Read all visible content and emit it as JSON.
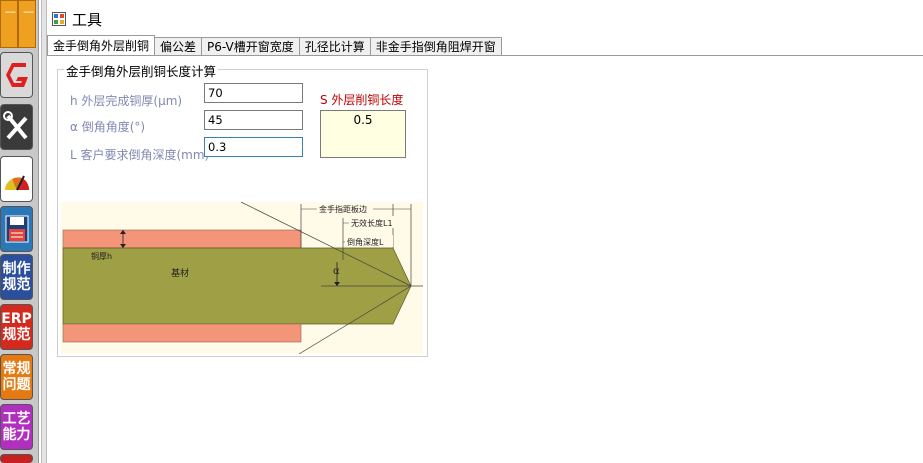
{
  "window": {
    "title": "工具"
  },
  "dock": {
    "items": [
      {
        "icon": "logo-g-icon"
      },
      {
        "icon": "tools-icon"
      },
      {
        "icon": "gauge-icon"
      },
      {
        "icon": "save-icon"
      },
      {
        "line1": "制作",
        "line2": "规范",
        "color": "#2b4f9c"
      },
      {
        "line1": "ERP",
        "line2": "规范",
        "color": "#d42a1e"
      },
      {
        "line1": "常规",
        "line2": "问题",
        "color": "#e57a12"
      },
      {
        "line1": "工艺",
        "line2": "能力",
        "color": "#b02fbf"
      }
    ]
  },
  "tabs": [
    {
      "label": "金手倒角外层削铜"
    },
    {
      "label": "偏公差"
    },
    {
      "label": "P6-V槽开窗宽度"
    },
    {
      "label": "孔径比计算"
    },
    {
      "label": "非金手指倒角阻焊开窗"
    }
  ],
  "form": {
    "group_title": "金手倒角外层削铜长度计算",
    "thickness_label": "h 外层完成铜厚(μm)",
    "thickness_value": "70",
    "angle_label": "α 倒角角度(°)",
    "angle_value": "45",
    "depth_label": "L 客户要求倒角深度(mm)",
    "depth_value": "0.3",
    "result_label": "S 外层削铜长度",
    "result_value": "0.5"
  },
  "diagram": {
    "edge_label": "金手指距板边",
    "invalid_label": "无效长度L1",
    "bevel_label": "倒角深度L",
    "copper_label": "铜厚h",
    "base_label": "基材",
    "alpha_label": "α",
    "colors": {
      "copper": "#f4957a",
      "substrate": "#9f9f45",
      "bg": "#fffbe8"
    }
  },
  "colors": {
    "label": "#7f8ab0",
    "result_label": "#c00000",
    "result_bg": "#ffffe1"
  }
}
